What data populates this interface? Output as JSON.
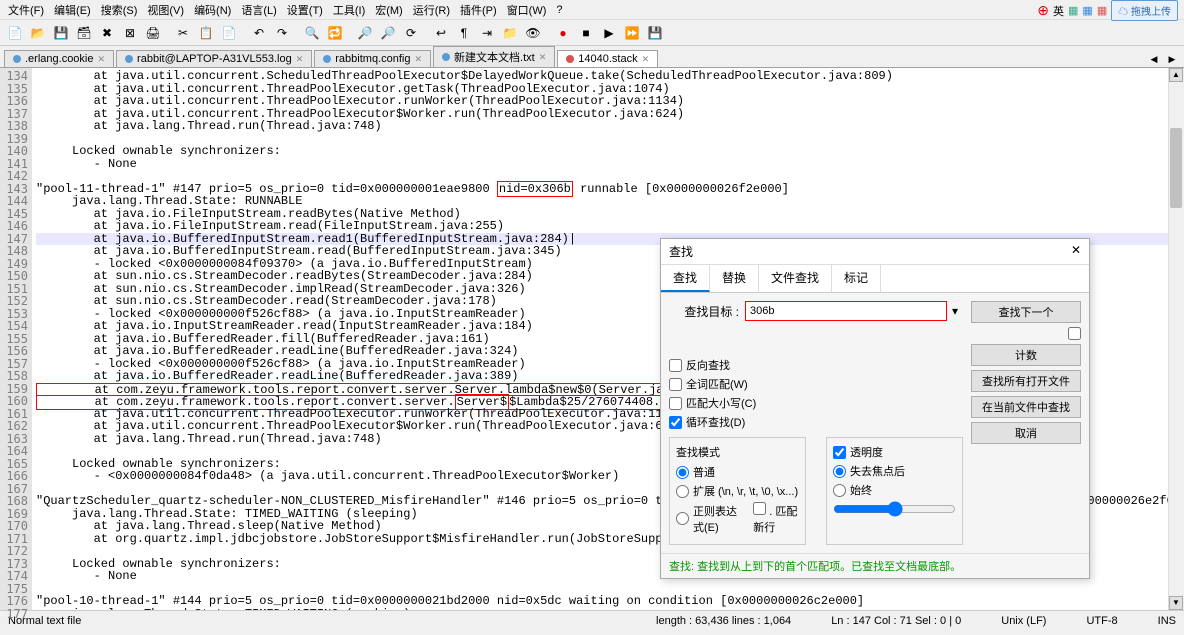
{
  "menu": [
    "文件(F)",
    "编辑(E)",
    "搜索(S)",
    "视图(V)",
    "编码(N)",
    "语言(L)",
    "设置(T)",
    "工具(I)",
    "宏(M)",
    "运行(R)",
    "插件(P)",
    "窗口(W)",
    "?"
  ],
  "topright": {
    "upload": "拖拽上传"
  },
  "tabs": [
    {
      "label": ".erlang.cookie",
      "active": false
    },
    {
      "label": "rabbit@LAPTOP-A31VL553.log",
      "active": false
    },
    {
      "label": "rabbitmq.config",
      "active": false
    },
    {
      "label": "新建文本文档.txt",
      "active": false
    },
    {
      "label": "14040.stack",
      "active": true
    }
  ],
  "lines_start": 134,
  "code": [
    "        at java.util.concurrent.ScheduledThreadPoolExecutor$DelayedWorkQueue.take(ScheduledThreadPoolExecutor.java:809)",
    "        at java.util.concurrent.ThreadPoolExecutor.getTask(ThreadPoolExecutor.java:1074)",
    "        at java.util.concurrent.ThreadPoolExecutor.runWorker(ThreadPoolExecutor.java:1134)",
    "        at java.util.concurrent.ThreadPoolExecutor$Worker.run(ThreadPoolExecutor.java:624)",
    "        at java.lang.Thread.run(Thread.java:748)",
    "",
    "     Locked ownable synchronizers:",
    "        - None",
    "",
    "\"pool-11-thread-1\" #147 prio=5 os_prio=0 tid=0x000000001eae9800 nid=0x306b runnable [0x0000000026f2e000]",
    "     java.lang.Thread.State: RUNNABLE",
    "        at java.io.FileInputStream.readBytes(Native Method)",
    "        at java.io.FileInputStream.read(FileInputStream.java:255)",
    "        at java.io.BufferedInputStream.read1(BufferedInputStream.java:284)",
    "        at java.io.BufferedInputStream.read(BufferedInputStream.java:345)",
    "        - locked <0x0000000084f09370> (a java.io.BufferedInputStream)",
    "        at sun.nio.cs.StreamDecoder.readBytes(StreamDecoder.java:284)",
    "        at sun.nio.cs.StreamDecoder.implRead(StreamDecoder.java:326)",
    "        at sun.nio.cs.StreamDecoder.read(StreamDecoder.java:178)",
    "        - locked <0x000000000f526cf88> (a java.io.InputStreamReader)",
    "        at java.io.InputStreamReader.read(InputStreamReader.java:184)",
    "        at java.io.BufferedReader.fill(BufferedReader.java:161)",
    "        at java.io.BufferedReader.readLine(BufferedReader.java:324)",
    "        - locked <0x000000000f526cf88> (a java.io.InputStreamReader)",
    "        at java.io.BufferedReader.readLine(BufferedReader.java:389)",
    "        at com.zeyu.framework.tools.report.convert.server.Server.lambda$new$0(Server.java:105)",
    "        at com.zeyu.framework.tools.report.convert.server.Server$$Lambda$25/276074408.run(Unknown Source)",
    "        at java.util.concurrent.ThreadPoolExecutor.runWorker(ThreadPoolExecutor.java:1149)",
    "        at java.util.concurrent.ThreadPoolExecutor$Worker.run(ThreadPoolExecutor.java:624)",
    "        at java.lang.Thread.run(Thread.java:748)",
    "",
    "     Locked ownable synchronizers:",
    "        - <0x0000000084f0da48> (a java.util.concurrent.ThreadPoolExecutor$Worker)",
    "",
    "\"QuartzScheduler_quartz-scheduler-NON_CLUSTERED_MisfireHandler\" #146 prio=5 os_prio=0 tid=0x0000000021bcd800 nid=0x4768 waiting on condition [0x0000000026e2f000]",
    "     java.lang.Thread.State: TIMED_WAITING (sleeping)",
    "        at java.lang.Thread.sleep(Native Method)",
    "        at org.quartz.impl.jdbcjobstore.JobStoreSupport$MisfireHandler.run(JobStoreSupport.java:3992)",
    "",
    "     Locked ownable synchronizers:",
    "        - None",
    "",
    "\"pool-10-thread-1\" #144 prio=5 os_prio=0 tid=0x0000000021bd2000 nid=0x5dc waiting on condition [0x0000000026c2e000]",
    "     java.lang.Thread.State: TIMED_WAITING (parking)"
  ],
  "highlight_line": 147,
  "redbox1": "nid=0x306b",
  "redbox2_part1": "Server$",
  "redbox2_rest": "$Lambda$25/276074408.run",
  "status": {
    "left": "Normal text file",
    "length": "length : 63,436    lines : 1,064",
    "pos": "Ln : 147   Col : 71   Sel : 0 | 0",
    "eol": "Unix (LF)",
    "enc": "UTF-8",
    "ins": "INS"
  },
  "dialog": {
    "title": "查找",
    "tabs": [
      "查找",
      "替换",
      "文件查找",
      "标记"
    ],
    "target_label": "查找目标 :",
    "target_value": "306b",
    "btns": [
      "查找下一个",
      "计数",
      "查找所有打开文件",
      "在当前文件中查找",
      "取消"
    ],
    "chk_reverse": "反向查找",
    "chk_whole": "全词匹配(W)",
    "chk_case": "匹配大小写(C)",
    "chk_wrap": "循环查找(D)",
    "mode_title": "查找模式",
    "mode_normal": "普通",
    "mode_ext": "扩展 (\\n, \\r, \\t, \\0, \\x...)",
    "mode_regex": "正则表达式(E)",
    "mode_regex_suffix": ". 匹配新行",
    "trans_title": "透明度",
    "trans_lose": "失去焦点后",
    "trans_always": "始终",
    "status_msg": "查找: 查找到从上到下的首个匹配项。已查找至文档最底部。"
  }
}
